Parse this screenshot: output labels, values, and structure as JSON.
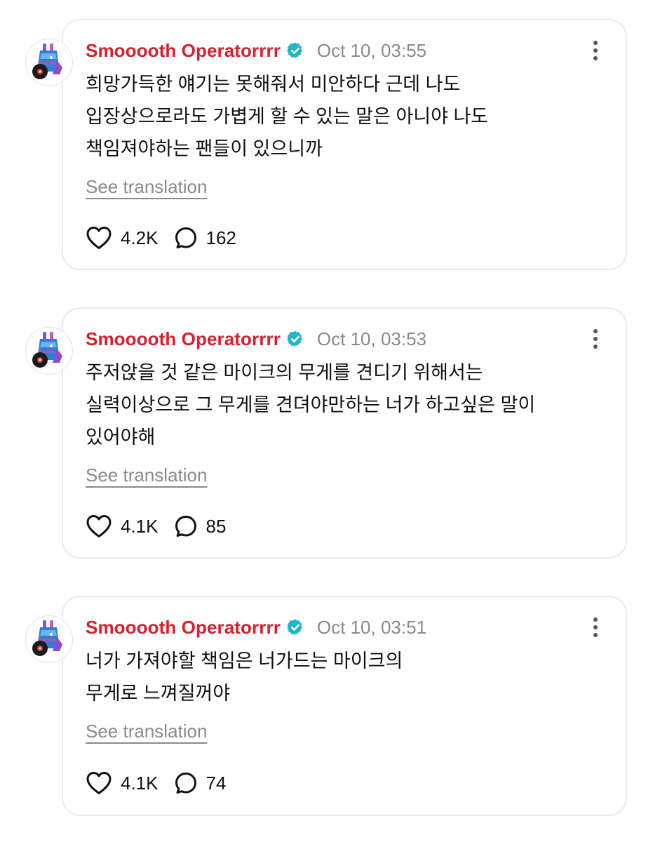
{
  "posts": [
    {
      "username": "Smooooth Operatorrrr",
      "timestamp": "Oct 10, 03:55",
      "lines": [
        "희망가득한 얘기는 못해줘서 미안하다 근데 나도",
        "입장상으로라도 가볍게 할 수 있는 말은 아니야 나도",
        "책임져야하는 팬들이 있으니까"
      ],
      "see_translation": "See translation",
      "likes": "4.2K",
      "replies": "162"
    },
    {
      "username": "Smooooth Operatorrrr",
      "timestamp": "Oct 10, 03:53",
      "lines": [
        "주저앉을 것 같은 마이크의 무게를 견디기 위해서는",
        "실력이상으로 그 무게를 견뎌야만하는 너가 하고싶은 말이",
        "있어야해"
      ],
      "see_translation": "See translation",
      "likes": "4.1K",
      "replies": "85"
    },
    {
      "username": "Smooooth Operatorrrr",
      "timestamp": "Oct 10, 03:51",
      "lines": [
        "너가 가져야할 책임은 너가드는 마이크의",
        "무게로 느껴질꺼야"
      ],
      "see_translation": "See translation",
      "likes": "4.1K",
      "replies": "74"
    }
  ],
  "icons": {
    "verified": "verified-badge-icon",
    "more": "more-options-icon",
    "like": "heart-icon",
    "reply": "reply-bubble-icon"
  },
  "colors": {
    "username": "#d6202f",
    "verified": "#1fb6c9",
    "muted": "#8a8a8e",
    "card_border": "#e9e9ef"
  }
}
